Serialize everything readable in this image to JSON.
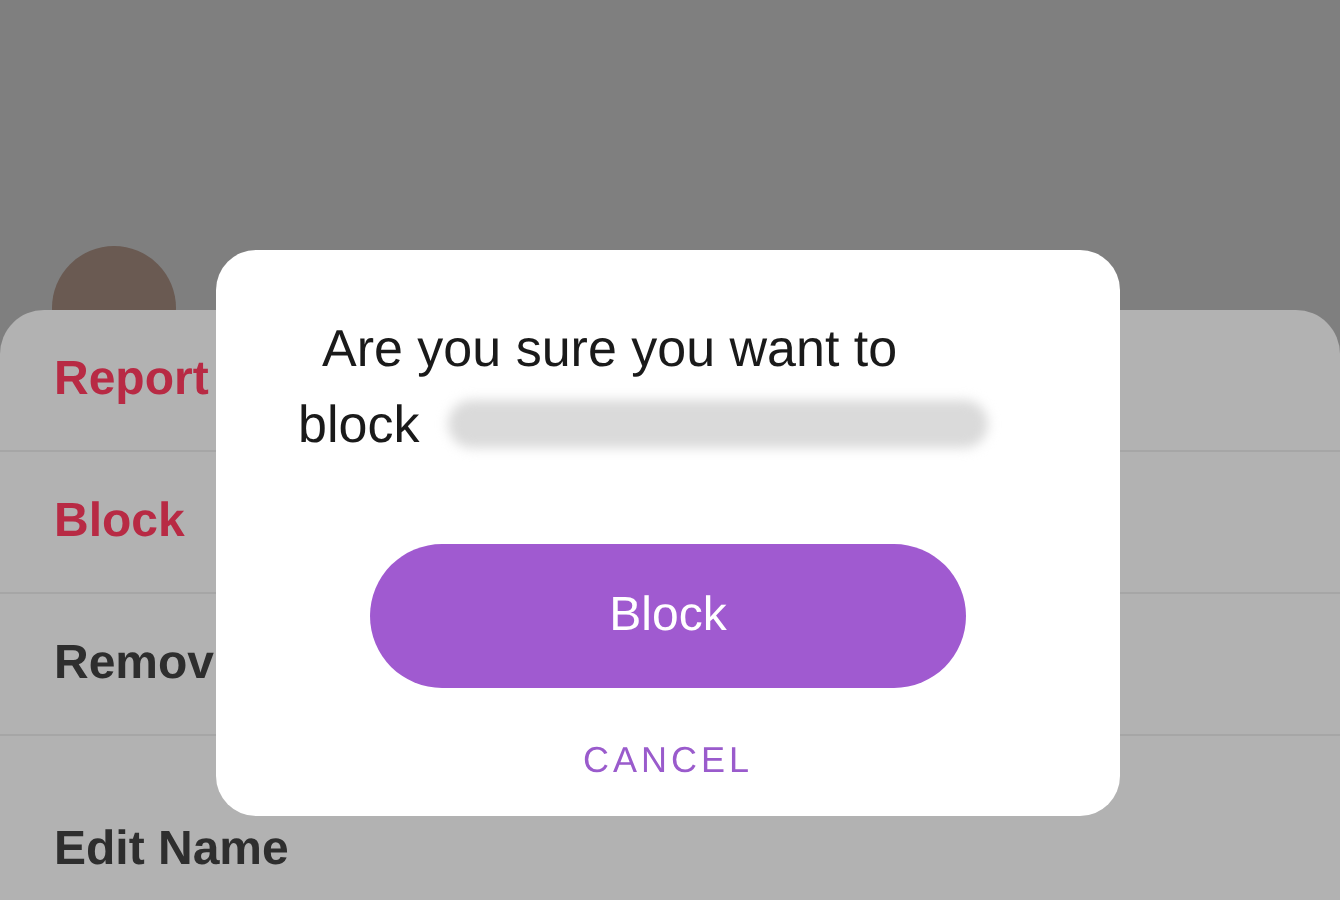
{
  "sheet": {
    "items": [
      {
        "label": "Report",
        "kind": "destructive"
      },
      {
        "label": "Block",
        "kind": "destructive"
      },
      {
        "label": "Remov",
        "kind": "normal"
      },
      {
        "label": "Edit Name",
        "kind": "normal"
      }
    ]
  },
  "dialog": {
    "message_lines": [
      "Are you sure you want to",
      "block"
    ],
    "buttons": [
      {
        "label": "Block",
        "kind": "primary"
      },
      {
        "label": "CANCEL",
        "kind": "text"
      }
    ]
  }
}
